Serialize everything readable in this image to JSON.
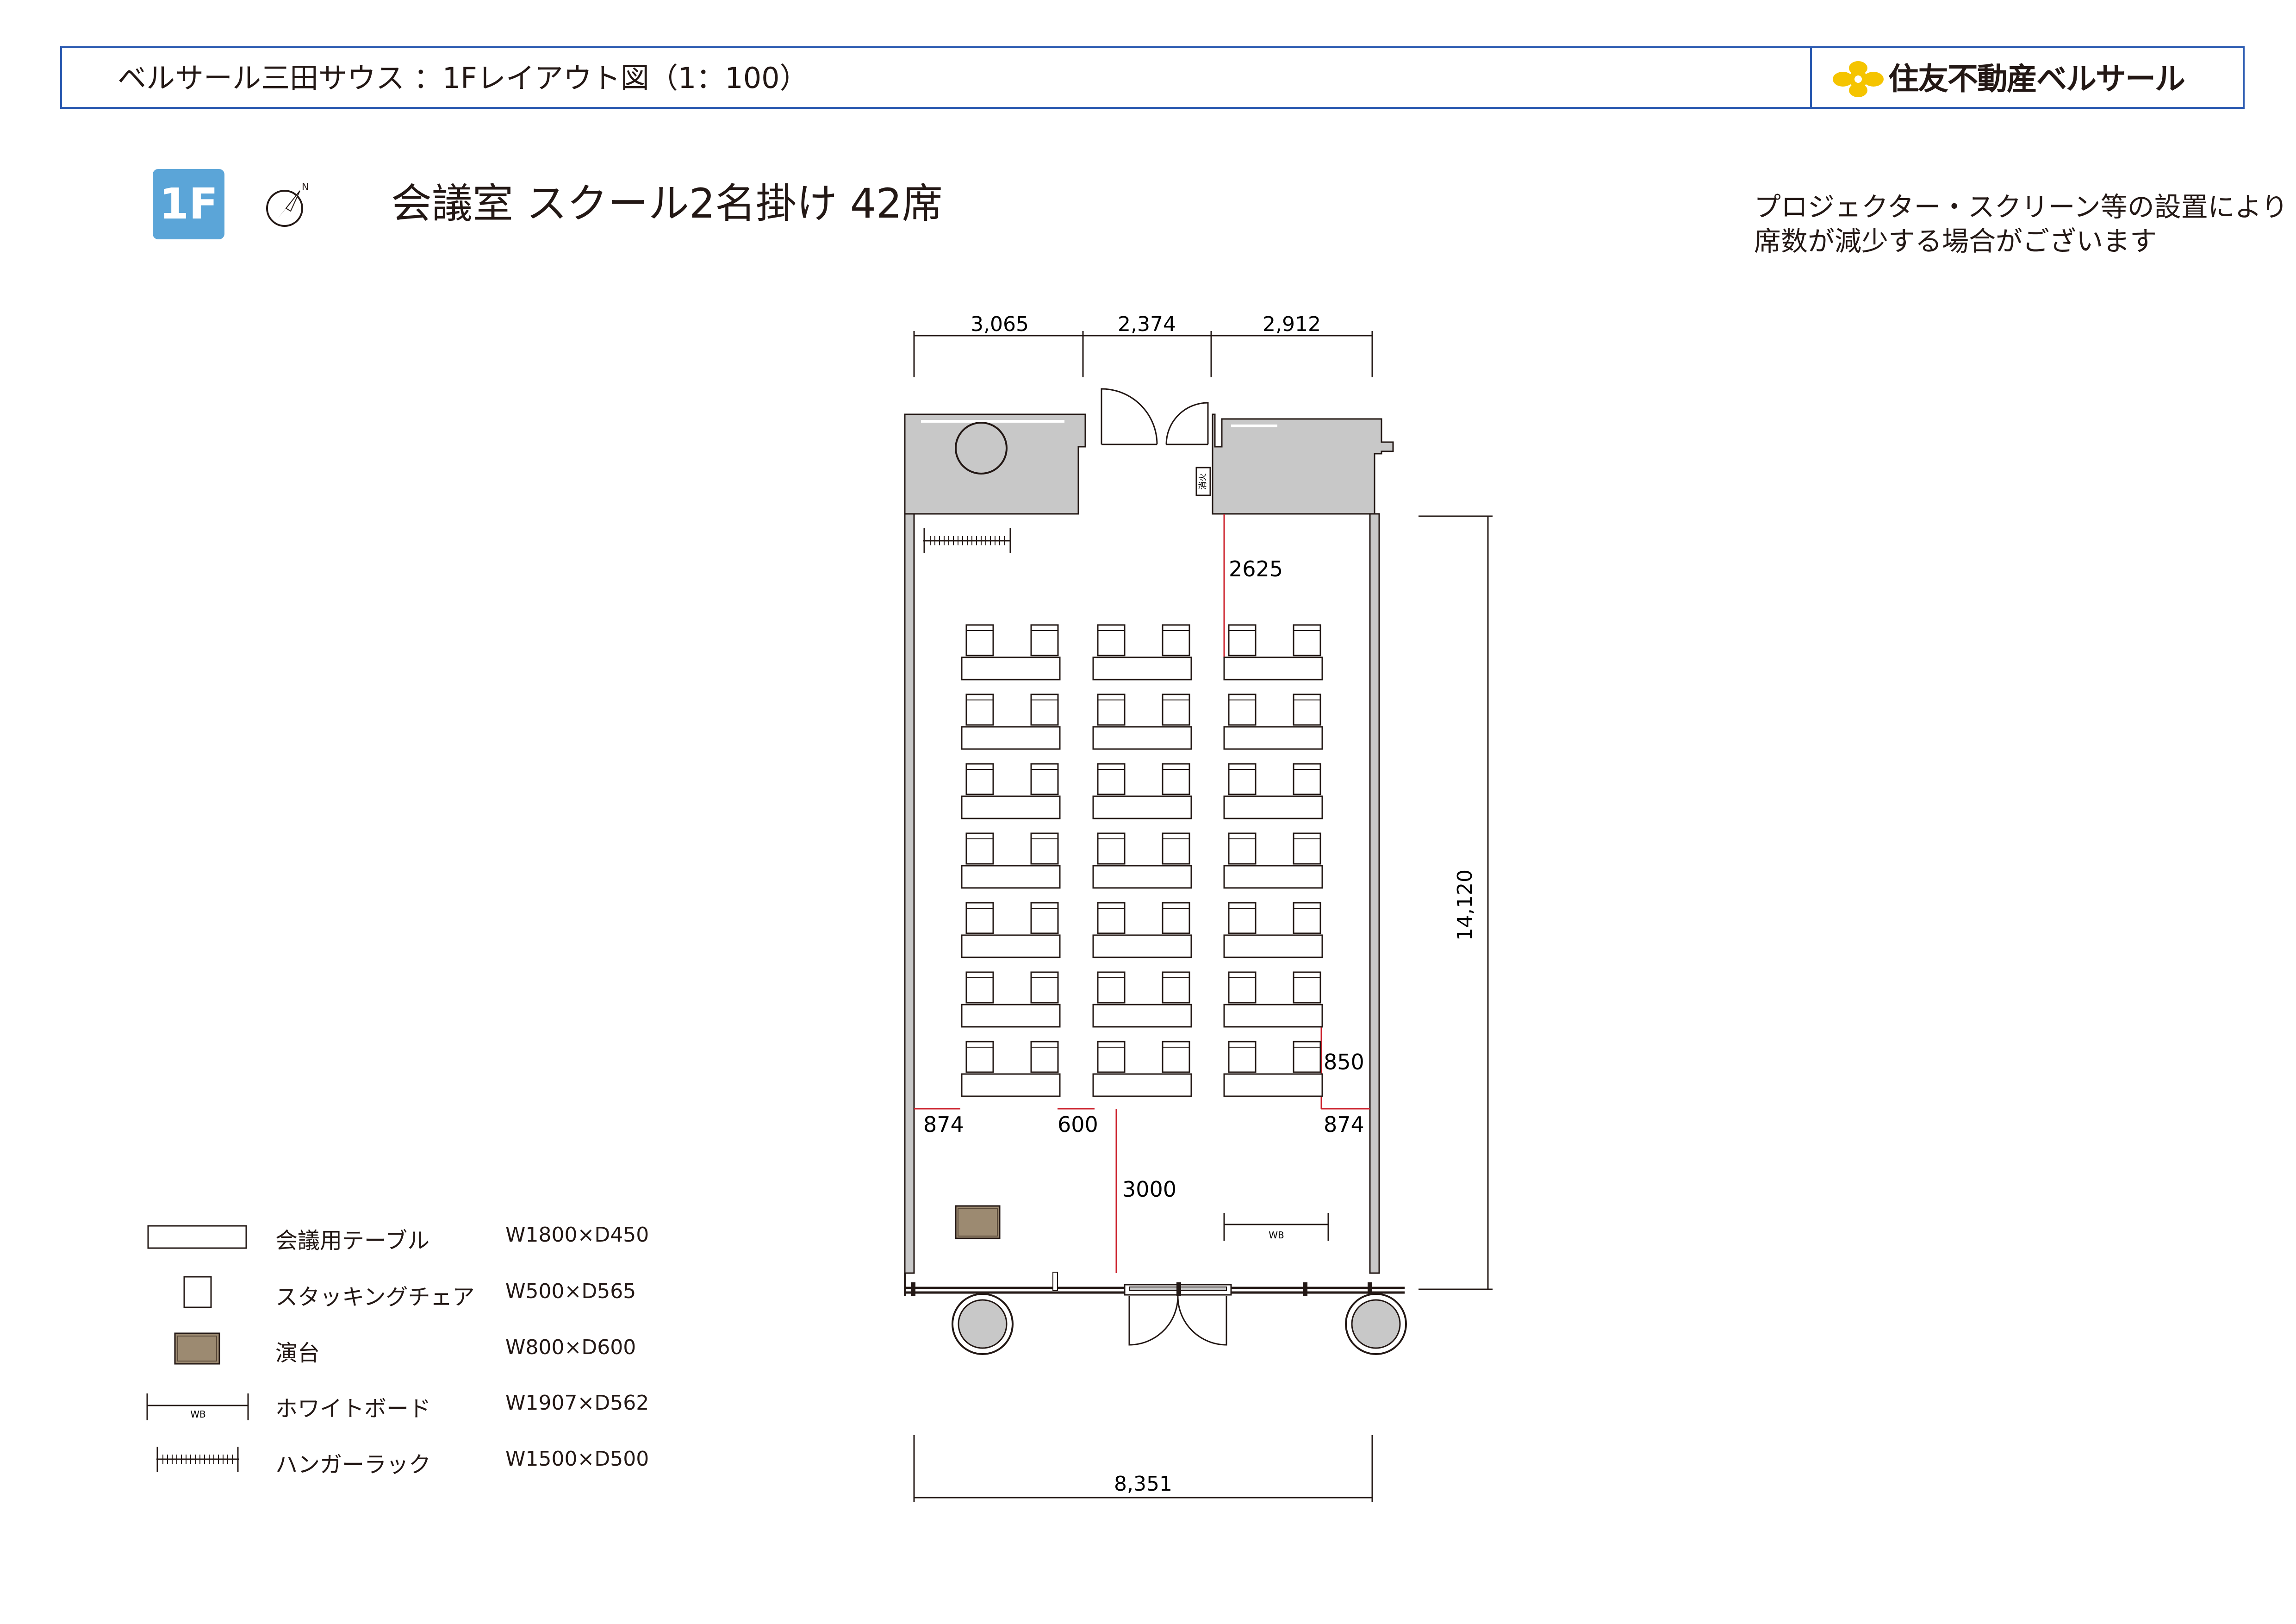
{
  "header": {
    "title": "ベルサール三田サウス ：1Fレイアウト図（1：100）",
    "brand": "住友不動産ベルサール"
  },
  "floor_badge": "1F",
  "layout_title": "会議室 スクール2名掛け 42席",
  "compass_label": "N",
  "notes": [
    "プロジェクター・スクリーン等の設置により",
    "席数が減少する場合がございます"
  ],
  "dimensions": {
    "top_left": "3,065",
    "top_center": "2,374",
    "top_right": "2,912",
    "height": "14,120",
    "bottom": "8,351",
    "front_gap": "2625",
    "row_pitch": "850",
    "left_margin": "874",
    "right_margin": "874",
    "aisle": "600",
    "back_space": "3000"
  },
  "fire_hydrant_label": "消火",
  "whiteboard_label": "WB",
  "seating": {
    "rows": 7,
    "table_groups": 3,
    "chairs_per_table": 2,
    "total_seats": 42
  },
  "legend": [
    {
      "label": "会議用テーブル",
      "spec": "W1800×D450",
      "icon": "table-icon"
    },
    {
      "label": "スタッキングチェア",
      "spec": "W500×D565",
      "icon": "chair-icon"
    },
    {
      "label": "演台",
      "spec": "W800×D600",
      "icon": "podium-icon"
    },
    {
      "label": "ホワイトボード",
      "spec": "W1907×D562",
      "icon": "whiteboard-icon"
    },
    {
      "label": "ハンガーラック",
      "spec": "W1500×D500",
      "icon": "hanger-rack-icon"
    }
  ],
  "colors": {
    "header_border": "#2c5bb1",
    "badge": "#5ba5d8",
    "dimension_line": "#cc1f2a",
    "wall_fill": "#c8c8c8",
    "podium": "#9c8a71",
    "brand_logo": "#f5c400"
  }
}
